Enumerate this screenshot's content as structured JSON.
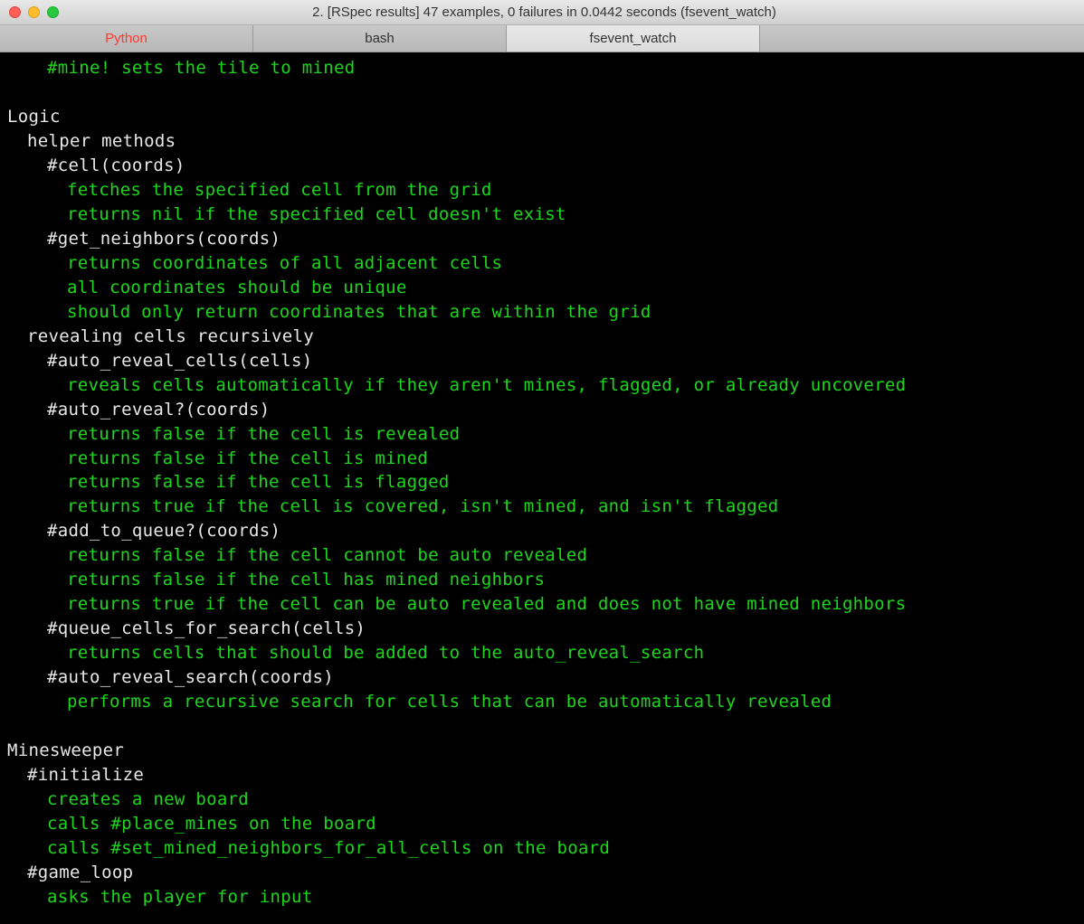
{
  "window": {
    "title": "2. [RSpec results] 47 examples, 0 failures in 0.0442 seconds (fsevent_watch)"
  },
  "tabs": [
    {
      "label": "Python",
      "class": "python"
    },
    {
      "label": "bash",
      "class": ""
    },
    {
      "label": "fsevent_watch",
      "class": "active"
    }
  ],
  "lines": [
    {
      "indent": 2,
      "color": "green",
      "text": "#mine! sets the tile to mined"
    },
    {
      "indent": 0,
      "color": "white",
      "text": ""
    },
    {
      "indent": 0,
      "color": "white",
      "text": "Logic"
    },
    {
      "indent": 1,
      "color": "white",
      "text": "helper methods"
    },
    {
      "indent": 2,
      "color": "white",
      "text": "#cell(coords)"
    },
    {
      "indent": 3,
      "color": "green",
      "text": "fetches the specified cell from the grid"
    },
    {
      "indent": 3,
      "color": "green",
      "text": "returns nil if the specified cell doesn't exist"
    },
    {
      "indent": 2,
      "color": "white",
      "text": "#get_neighbors(coords)"
    },
    {
      "indent": 3,
      "color": "green",
      "text": "returns coordinates of all adjacent cells"
    },
    {
      "indent": 3,
      "color": "green",
      "text": "all coordinates should be unique"
    },
    {
      "indent": 3,
      "color": "green",
      "text": "should only return coordinates that are within the grid"
    },
    {
      "indent": 1,
      "color": "white",
      "text": "revealing cells recursively"
    },
    {
      "indent": 2,
      "color": "white",
      "text": "#auto_reveal_cells(cells)"
    },
    {
      "indent": 3,
      "color": "green",
      "text": "reveals cells automatically if they aren't mines, flagged, or already uncovered"
    },
    {
      "indent": 2,
      "color": "white",
      "text": "#auto_reveal?(coords)"
    },
    {
      "indent": 3,
      "color": "green",
      "text": "returns false if the cell is revealed"
    },
    {
      "indent": 3,
      "color": "green",
      "text": "returns false if the cell is mined"
    },
    {
      "indent": 3,
      "color": "green",
      "text": "returns false if the cell is flagged"
    },
    {
      "indent": 3,
      "color": "green",
      "text": "returns true if the cell is covered, isn't mined, and isn't flagged"
    },
    {
      "indent": 2,
      "color": "white",
      "text": "#add_to_queue?(coords)"
    },
    {
      "indent": 3,
      "color": "green",
      "text": "returns false if the cell cannot be auto revealed"
    },
    {
      "indent": 3,
      "color": "green",
      "text": "returns false if the cell has mined neighbors"
    },
    {
      "indent": 3,
      "color": "green",
      "text": "returns true if the cell can be auto revealed and does not have mined neighbors"
    },
    {
      "indent": 2,
      "color": "white",
      "text": "#queue_cells_for_search(cells)"
    },
    {
      "indent": 3,
      "color": "green",
      "text": "returns cells that should be added to the auto_reveal_search"
    },
    {
      "indent": 2,
      "color": "white",
      "text": "#auto_reveal_search(coords)"
    },
    {
      "indent": 3,
      "color": "green",
      "text": "performs a recursive search for cells that can be automatically revealed"
    },
    {
      "indent": 0,
      "color": "white",
      "text": ""
    },
    {
      "indent": 0,
      "color": "white",
      "text": "Minesweeper"
    },
    {
      "indent": 1,
      "color": "white",
      "text": "#initialize"
    },
    {
      "indent": 2,
      "color": "green",
      "text": "creates a new board"
    },
    {
      "indent": 2,
      "color": "green",
      "text": "calls #place_mines on the board"
    },
    {
      "indent": 2,
      "color": "green",
      "text": "calls #set_mined_neighbors_for_all_cells on the board"
    },
    {
      "indent": 1,
      "color": "white",
      "text": "#game_loop"
    },
    {
      "indent": 2,
      "color": "green",
      "text": "asks the player for input"
    }
  ]
}
